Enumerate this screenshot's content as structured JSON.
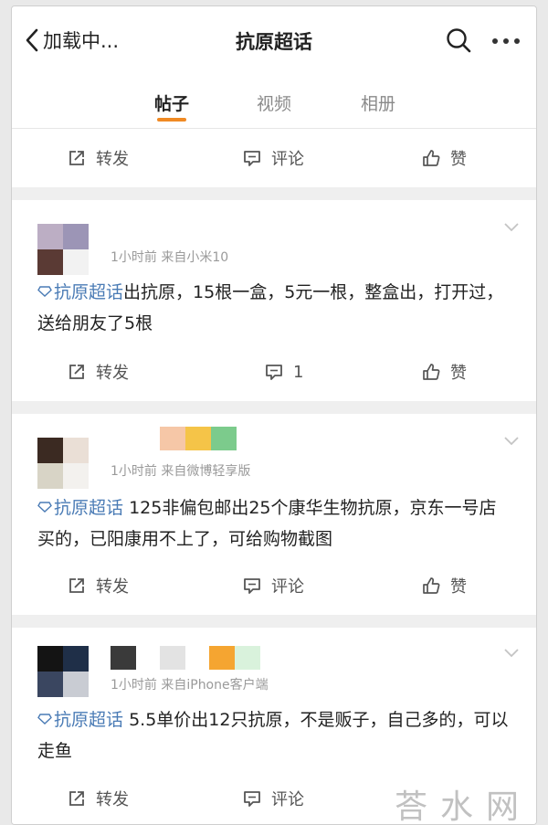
{
  "header": {
    "back_label": "加载中...",
    "title": "抗原超话"
  },
  "tabs": [
    {
      "label": "帖子",
      "active": true
    },
    {
      "label": "视频",
      "active": false
    },
    {
      "label": "相册",
      "active": false
    }
  ],
  "actions": {
    "repost": "转发",
    "comment": "评论",
    "like": "赞"
  },
  "posts": [
    {
      "meta": "1小时前  来自小米10",
      "topic": "抗原超话",
      "text": "出抗原，15根一盒，5元一根，整盒出，打开过，送给朋友了5根",
      "comment_count": "1"
    },
    {
      "meta": "1小时前  来自微博轻享版",
      "topic": "抗原超话",
      "text": "125非偏包邮出25个康华生物抗原，京东一号店买的，已阳康用不上了，可给购物截图"
    },
    {
      "meta": "1小时前  来自iPhone客户端",
      "topic": "抗原超话",
      "text": "5.5单价出12只抗原，不是贩子，自己多的，可以走鱼"
    }
  ],
  "watermark": "荅水网",
  "colors": {
    "accent": "#f08a24",
    "topic_link": "#4a7bb5",
    "meta_gray": "#9a9a9a"
  }
}
